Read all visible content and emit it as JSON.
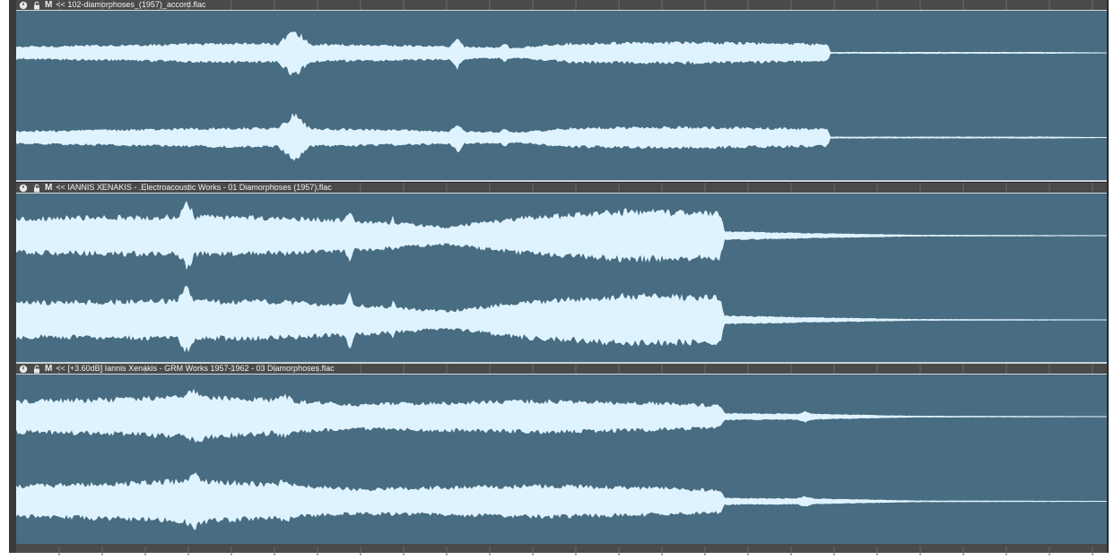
{
  "tracks": [
    {
      "clip_name": "<< 102-diamorphoses_(1957)_accord.flac",
      "icons": [
        "power-icon",
        "lock-icon"
      ],
      "mute_label": "M"
    },
    {
      "clip_name": "<< IANNIS XENAKIS - .Electroacoustic Works - 01 Diamorphoses (1957).flac",
      "icons": [
        "power-icon",
        "lock-icon"
      ],
      "mute_label": "M"
    },
    {
      "clip_name": "<< [+3.60dB] Iannis Xenakis - GRM Works 1957-1962 - 03 Diamorphoses.flac",
      "icons": [
        "power-icon",
        "lock-icon"
      ],
      "mute_label": "M"
    }
  ],
  "colors": {
    "lane_background": "#486c81",
    "waveform": "#dff3ff",
    "header_background": "#4a4a4a",
    "header_text": "#f2f2f2"
  }
}
